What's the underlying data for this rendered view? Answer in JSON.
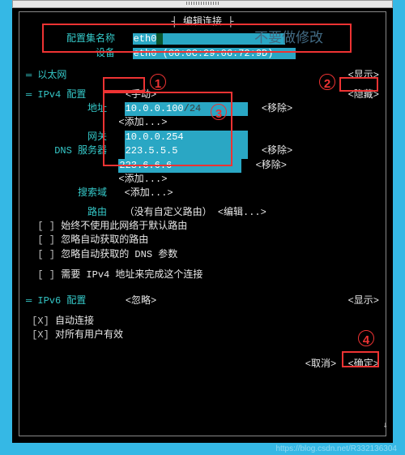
{
  "header": {
    "title": "编辑连接"
  },
  "profile": {
    "name_label": "配置集名称",
    "name_value": "eth0",
    "device_label": "设备",
    "device_value": "eth0 (00:0C:29:06:72:9D)"
  },
  "annotate": {
    "note_text": "不要做修改",
    "n1": "1",
    "n2": "2",
    "n3": "3",
    "n4": "4"
  },
  "ethernet": {
    "section": "以太网",
    "show": "<显示>"
  },
  "ipv4": {
    "section": "IPv4 配置",
    "mode": "<手动>",
    "hide": "<隐藏>",
    "address_label": "地址",
    "address_value": "10.0.0.100",
    "address_mask": "/24",
    "add": "<添加...>",
    "remove": "<移除>",
    "gateway_label": "网关",
    "gateway_value": "10.0.0.254",
    "dns_label": "DNS 服务器",
    "dns1": "223.5.5.5",
    "dns2": "223.6.6.6",
    "search_label": "搜索域",
    "route_label": "路由",
    "route_value": "（没有自定义路由）",
    "route_edit": "<编辑...>",
    "chk1": "始终不使用此网络于默认路由",
    "chk2": "忽略自动获取的路由",
    "chk3": "忽略自动获取的 DNS 参数",
    "chk4": "需要 IPv4 地址来完成这个连接"
  },
  "ipv6": {
    "section": "IPv6 配置",
    "mode": "<忽略>",
    "show": "<显示>"
  },
  "bottom": {
    "auto": "自动连接",
    "allusers": "对所有用户有效",
    "cancel": "<取消>",
    "ok": "<确定>"
  },
  "footer": {
    "watermark": "https://blog.csdn.net/R332136304"
  }
}
